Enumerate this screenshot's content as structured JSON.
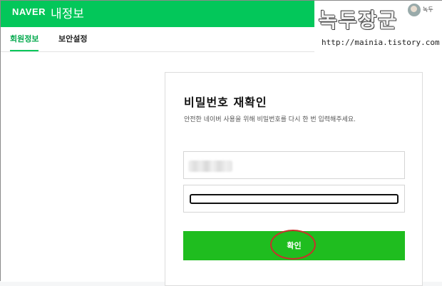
{
  "header": {
    "logo": "NAVER",
    "title": "내정보",
    "user_name": "녹두"
  },
  "nav": {
    "tabs": [
      {
        "label": "회원정보",
        "active": true
      },
      {
        "label": "보안설정",
        "active": false
      }
    ]
  },
  "form": {
    "title": "비밀번호 재확인",
    "description": "안전한 네이버 사용을 위해 비밀번호를 다시 한 번 입력해주세요.",
    "confirm_label": "확인"
  },
  "watermark": {
    "text": "녹두장군",
    "url": "http://mainia.tistory.com"
  },
  "colors": {
    "brand": "#03c75a",
    "button": "#1fbd1f",
    "annotation": "#c9302c"
  }
}
